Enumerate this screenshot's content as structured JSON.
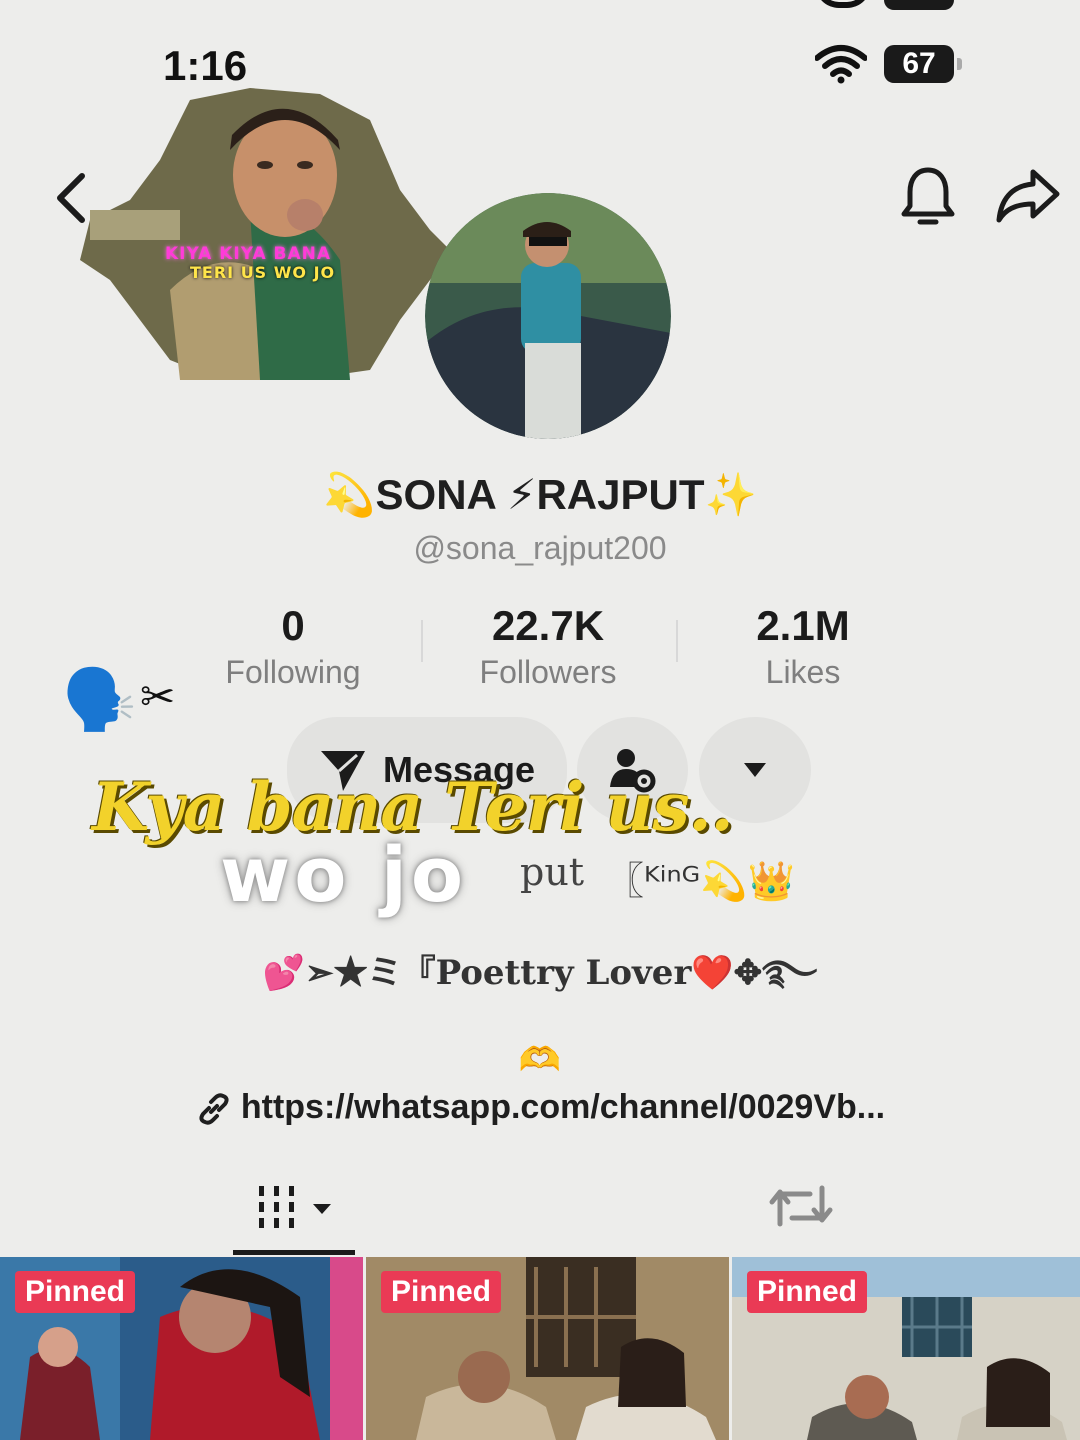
{
  "status_bar": {
    "time": "1:16",
    "battery": "67"
  },
  "profile": {
    "display_name": "💫SONA ⚡RAJPUT✨",
    "handle": "@sona_rajput200",
    "stats": [
      {
        "value": "0",
        "label": "Following"
      },
      {
        "value": "22.7K",
        "label": "Followers"
      },
      {
        "value": "2.1M",
        "label": "Likes"
      }
    ]
  },
  "actions": {
    "message_label": "Message"
  },
  "sticker": {
    "line1": "KIYA KIYA BANA",
    "line2": "TERI US WO JO"
  },
  "overlay": {
    "caption_yellow": "Kya bana Teri us..",
    "caption_white": "wo jo"
  },
  "bio": {
    "line1_fragment": "put",
    "king": "〖ᴷⁱⁿᴳ💫👑",
    "line2": "💕➣★ミ『Poettry Lover❤️✥࿐",
    "heart_hands": "🫶",
    "link": "https://whatsapp.com/channel/0029Vb..."
  },
  "decor": {
    "speaking_head": "🗣️",
    "scissors": "✂"
  },
  "videos": [
    {
      "badge": "Pinned"
    },
    {
      "badge": "Pinned"
    },
    {
      "badge": "Pinned"
    }
  ],
  "icons": {
    "back": "back-chevron-icon",
    "bell": "bell-icon",
    "share": "share-icon",
    "message": "send-icon",
    "profile_settings": "user-gear-icon",
    "more": "triangle-down-icon",
    "grid_tab": "grid-icon",
    "repost_tab": "repost-icon",
    "link": "link-icon"
  },
  "colors": {
    "background": "#ededeb",
    "pinned_badge": "#ea3a55",
    "caption_yellow": "#f2d22b"
  }
}
